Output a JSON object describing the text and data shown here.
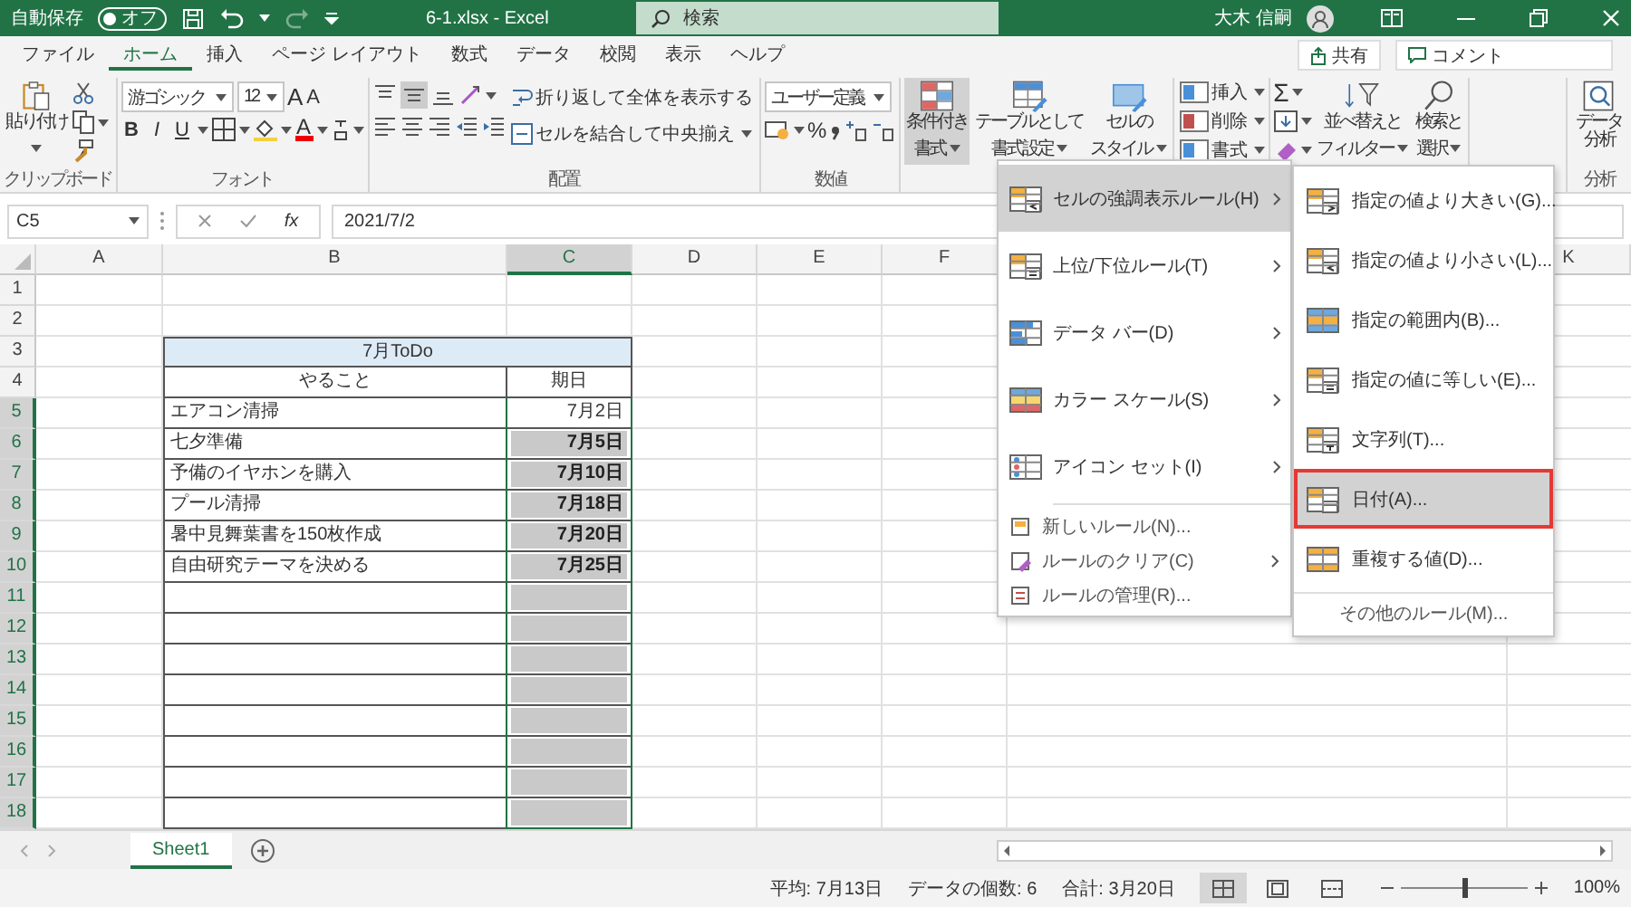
{
  "title_bar": {
    "autosave_label": "自動保存",
    "autosave": {
      "label": "オフ",
      "on": false
    },
    "title": "6-1.xlsx - Excel",
    "search": {
      "placeholder": "検索"
    },
    "user": "大木 信嗣"
  },
  "tabs": [
    {
      "label": "ファイル",
      "selected": false
    },
    {
      "label": "ホーム",
      "selected": true
    },
    {
      "label": "挿入",
      "selected": false
    },
    {
      "label": "ページ レイアウト",
      "selected": false
    },
    {
      "label": "数式",
      "selected": false
    },
    {
      "label": "データ",
      "selected": false
    },
    {
      "label": "校閲",
      "selected": false
    },
    {
      "label": "表示",
      "selected": false
    },
    {
      "label": "ヘルプ",
      "selected": false
    }
  ],
  "share": "共有",
  "comment": "コメント",
  "ribbon": {
    "clipboard": {
      "label": "クリップボード",
      "paste": "貼り付け"
    },
    "font": {
      "label": "フォント",
      "font_name": "游ゴシック",
      "font_size": "12",
      "grow": "A",
      "shrink": "A",
      "styles": [
        "B",
        "I",
        "U"
      ],
      "font_color": "A"
    },
    "alignment": {
      "label": "配置",
      "wrap": "折り返して全体を表示する",
      "merge": "セルを結合して中央揃え"
    },
    "number": {
      "label": "数値",
      "format": "ユーザー定義",
      "percent": "%"
    },
    "styles": {
      "buttons": [
        {
          "lines": [
            "条件付き",
            "書式"
          ],
          "kind": "conditional",
          "selected": true
        },
        {
          "lines": [
            "テーブルとして",
            "書式設定"
          ],
          "kind": "table",
          "selected": false
        },
        {
          "lines": [
            "セルの",
            "スタイル"
          ],
          "kind": "cellstyle",
          "selected": false
        }
      ]
    },
    "cells": {
      "buttons": [
        {
          "label": "挿入",
          "kind": "insert"
        },
        {
          "label": "削除",
          "kind": "delete"
        },
        {
          "label": "書式",
          "kind": "format"
        }
      ]
    },
    "editing": {
      "autosum": "Σ",
      "sort": [
        "並べ替えと",
        "フィルター"
      ],
      "find": [
        "検索と",
        "選択"
      ]
    },
    "analysis": {
      "label": "分析",
      "button": [
        "データ",
        "分析"
      ]
    }
  },
  "formula_bar": {
    "name_box": "C5",
    "function_symbol": "fx",
    "value": "2021/7/2"
  },
  "sheet": {
    "columns": [
      {
        "label": "A",
        "selected": false
      },
      {
        "label": "B",
        "selected": false
      },
      {
        "label": "C",
        "selected": true
      },
      {
        "label": "D",
        "selected": false
      },
      {
        "label": "E",
        "selected": false
      },
      {
        "label": "F",
        "selected": false
      },
      {
        "label": "K",
        "selected": false
      }
    ],
    "rows": [
      {
        "number": "1",
        "kind": "blank",
        "selected": false
      },
      {
        "number": "2",
        "kind": "blank",
        "selected": false
      },
      {
        "number": "3",
        "kind": "title",
        "title": "7月ToDo",
        "selected": false
      },
      {
        "number": "4",
        "kind": "header",
        "task": "やること",
        "due": "期日",
        "selected": false
      },
      {
        "number": "5",
        "kind": "item",
        "task": "エアコン清掃",
        "due": "7月2日",
        "highlighted": false,
        "selected": true
      },
      {
        "number": "6",
        "kind": "item",
        "task": "七夕準備",
        "due": "7月5日",
        "highlighted": true,
        "selected": true
      },
      {
        "number": "7",
        "kind": "item",
        "task": "予備のイヤホンを購入",
        "due": "7月10日",
        "highlighted": true,
        "selected": true
      },
      {
        "number": "8",
        "kind": "item",
        "task": "プール清掃",
        "due": "7月18日",
        "highlighted": true,
        "selected": true
      },
      {
        "number": "9",
        "kind": "item",
        "task": "暑中見舞葉書を150枚作成",
        "due": "7月20日",
        "highlighted": true,
        "selected": true
      },
      {
        "number": "10",
        "kind": "item",
        "task": "自由研究テーマを決める",
        "due": "7月25日",
        "highlighted": true,
        "selected": true
      },
      {
        "number": "11",
        "kind": "item",
        "highlighted": true,
        "selected": true
      },
      {
        "number": "12",
        "kind": "item",
        "highlighted": true,
        "selected": true
      },
      {
        "number": "13",
        "kind": "item",
        "highlighted": true,
        "selected": true
      },
      {
        "number": "14",
        "kind": "item",
        "highlighted": true,
        "selected": true
      },
      {
        "number": "15",
        "kind": "item",
        "highlighted": true,
        "selected": true
      },
      {
        "number": "16",
        "kind": "item",
        "highlighted": true,
        "selected": true
      },
      {
        "number": "17",
        "kind": "item",
        "highlighted": true,
        "selected": true
      },
      {
        "number": "18",
        "kind": "item",
        "highlighted": true,
        "selected": true
      }
    ]
  },
  "sheet_tabs": [
    {
      "label": "Sheet1",
      "selected": true
    }
  ],
  "status_bar": {
    "stats": [
      "平均: 7月13日",
      "データの個数: 6",
      "合計: 3月20日"
    ],
    "views": [
      {
        "kind": "normal",
        "selected": true
      },
      {
        "kind": "page_layout",
        "selected": false
      },
      {
        "kind": "page_break",
        "selected": false
      }
    ],
    "zoom": {
      "level": 0.5,
      "reading": "100%"
    }
  },
  "conditional_menu": {
    "items": [
      {
        "label": "セルの強調表示ルール(H)",
        "kind": "highlight",
        "has_submenu": true,
        "selected": true
      },
      {
        "label": "上位/下位ルール(T)",
        "kind": "topbottom",
        "has_submenu": true,
        "selected": false
      },
      {
        "label": "データ バー(D)",
        "kind": "databar",
        "has_submenu": true,
        "selected": false
      },
      {
        "label": "カラー スケール(S)",
        "kind": "colorscale",
        "has_submenu": true,
        "selected": false
      },
      {
        "label": "アイコン セット(I)",
        "kind": "iconset",
        "has_submenu": true,
        "selected": false
      }
    ],
    "manage_items": [
      {
        "label": "新しいルール(N)...",
        "kind": "new",
        "has_submenu": false
      },
      {
        "label": "ルールのクリア(C)",
        "kind": "clear",
        "has_submenu": true
      },
      {
        "label": "ルールの管理(R)...",
        "kind": "manage",
        "has_submenu": false
      }
    ],
    "submenu": {
      "items": [
        {
          "label": "指定の値より大きい(G)...",
          "kind": "greater",
          "selected": false
        },
        {
          "label": "指定の値より小さい(L)...",
          "kind": "less",
          "selected": false
        },
        {
          "label": "指定の範囲内(B)...",
          "kind": "between",
          "selected": false
        },
        {
          "label": "指定の値に等しい(E)...",
          "kind": "equal",
          "selected": false
        },
        {
          "label": "文字列(T)...",
          "kind": "text",
          "selected": false
        },
        {
          "label": "日付(A)...",
          "kind": "date",
          "selected": true,
          "annotated": true
        },
        {
          "label": "重複する値(D)...",
          "kind": "duplicate",
          "selected": false
        }
      ],
      "footer": "その他のルール(M)..."
    }
  }
}
